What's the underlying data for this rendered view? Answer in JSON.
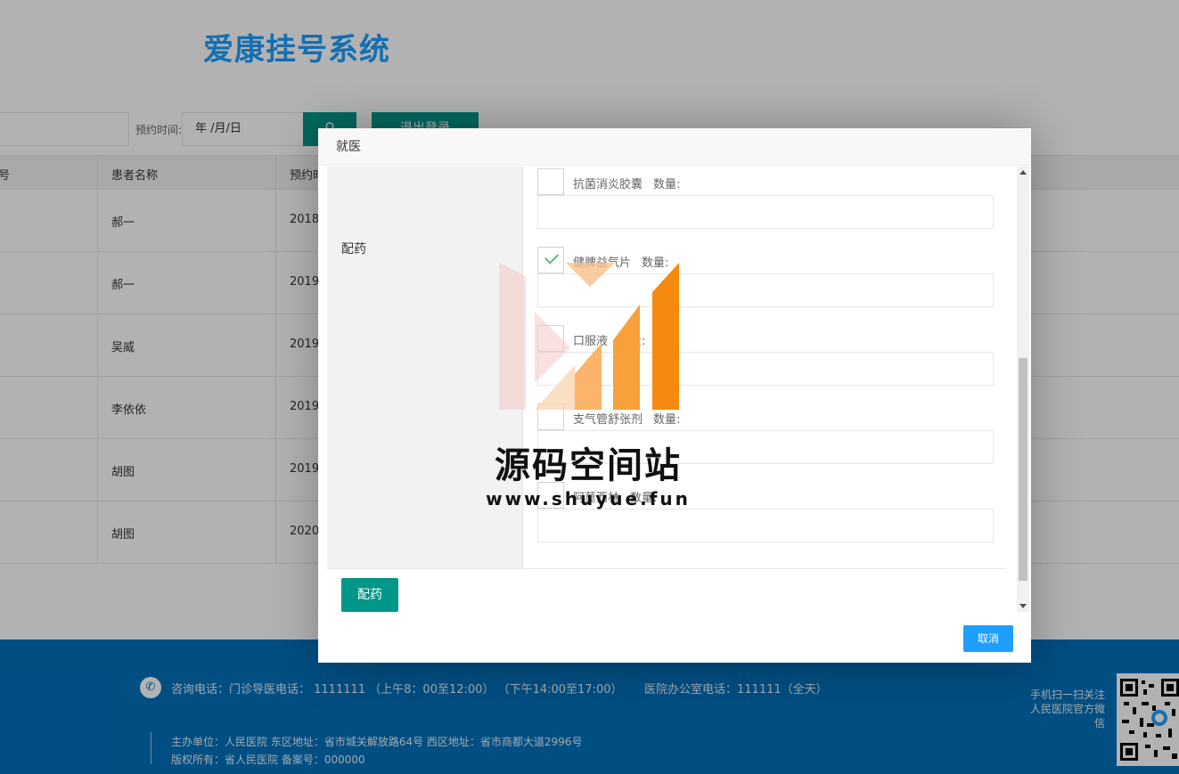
{
  "page": {
    "title": "爱康挂号系统",
    "date_label": "预约时间:",
    "date_placeholder": "年 /月/日",
    "search_icon": "search-icon",
    "logout_label": "退出登录"
  },
  "table": {
    "col_no": "号",
    "col_patient": "患者名称",
    "col_time": "预约时",
    "rows": [
      {
        "patient": "郝一",
        "time": "2018"
      },
      {
        "patient": "郝一",
        "time": "2019"
      },
      {
        "patient": "吴威",
        "time": "2019"
      },
      {
        "patient": "李依依",
        "time": "2019"
      },
      {
        "patient": "胡图",
        "time": "2019"
      },
      {
        "patient": "胡图",
        "time": "2020"
      }
    ]
  },
  "footer": {
    "contact": "咨询电话：门诊导医电话： 1111111 （上午8：00至12:00） （下午14:00至17:00）",
    "office": "医院办公室电话：111111（全天）",
    "line1": "主办单位：人民医院     东区地址：省市城关解放路64号     西区地址：省市商都大道2996号",
    "line2": "版权所有：省人民医院     备案号：000000",
    "qr_text": "手机扫一扫关注人民医院官方微信"
  },
  "modal": {
    "title": "就医",
    "section_label": "配药",
    "qty_label": "数量:",
    "medicines": [
      {
        "name": "抗菌消炎胶囊",
        "checked": false,
        "qty": ""
      },
      {
        "name": "健脾益气片",
        "checked": true,
        "qty": ""
      },
      {
        "name": "口服液",
        "checked": false,
        "qty": ""
      },
      {
        "name": "支气管舒张剂",
        "checked": false,
        "qty": ""
      },
      {
        "name": "阿莫西林",
        "checked": false,
        "qty": ""
      }
    ],
    "dispense_label": "配药",
    "cancel_label": "取消"
  },
  "watermark": {
    "text": "源码空间站",
    "url": "www.shuyue.fun"
  },
  "colors": {
    "brand_blue": "#1e9fff",
    "teal": "#009688",
    "footer_blue": "#0070bb"
  }
}
